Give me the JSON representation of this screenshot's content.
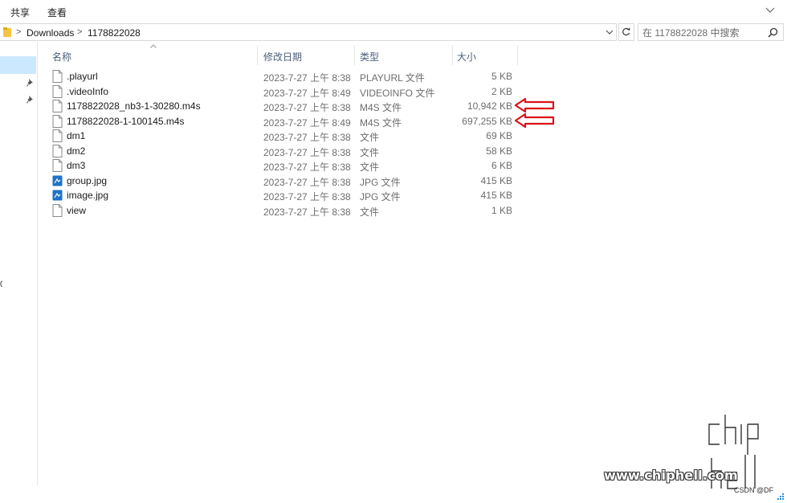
{
  "ribbon": {
    "tabs": [
      "共享",
      "查看"
    ]
  },
  "address": {
    "crumbs": [
      "Downloads",
      "1178822028"
    ],
    "separator": ">"
  },
  "search": {
    "placeholder": "在 1178822028 中搜索"
  },
  "columns": {
    "name": "名称",
    "date": "修改日期",
    "type": "类型",
    "size": "大小"
  },
  "files": [
    {
      "name": ".playurl",
      "date": "2023-7-27 上午 8:38",
      "type": "PLAYURL 文件",
      "size": "5 KB",
      "icon": "file-icon"
    },
    {
      "name": ".videoInfo",
      "date": "2023-7-27 上午 8:49",
      "type": "VIDEOINFO 文件",
      "size": "2 KB",
      "icon": "file-icon"
    },
    {
      "name": "1178822028_nb3-1-30280.m4s",
      "date": "2023-7-27 上午 8:38",
      "type": "M4S 文件",
      "size": "10,942 KB",
      "icon": "file-icon"
    },
    {
      "name": "1178822028-1-100145.m4s",
      "date": "2023-7-27 上午 8:49",
      "type": "M4S 文件",
      "size": "697,255 KB",
      "icon": "file-icon"
    },
    {
      "name": "dm1",
      "date": "2023-7-27 上午 8:38",
      "type": "文件",
      "size": "69 KB",
      "icon": "file-icon"
    },
    {
      "name": "dm2",
      "date": "2023-7-27 上午 8:38",
      "type": "文件",
      "size": "58 KB",
      "icon": "file-icon"
    },
    {
      "name": "dm3",
      "date": "2023-7-27 上午 8:38",
      "type": "文件",
      "size": "6 KB",
      "icon": "file-icon"
    },
    {
      "name": "group.jpg",
      "date": "2023-7-27 上午 8:38",
      "type": "JPG 文件",
      "size": "415 KB",
      "icon": "image-file-icon"
    },
    {
      "name": "image.jpg",
      "date": "2023-7-27 上午 8:38",
      "type": "JPG 文件",
      "size": "415 KB",
      "icon": "image-file-icon"
    },
    {
      "name": "view",
      "date": "2023-7-27 上午 8:38",
      "type": "文件",
      "size": "1 KB",
      "icon": "file-icon"
    }
  ],
  "nav": {
    "stub": "0"
  },
  "watermark": {
    "site": "www.chiphell.com",
    "csdn": "CSDN @DF"
  },
  "colors": {
    "selection": "#cce8ff",
    "header_text": "#4c607a",
    "annotation_arrow": "#d9141a",
    "folder": "#f5c542",
    "image_icon": "#1e73c8"
  }
}
